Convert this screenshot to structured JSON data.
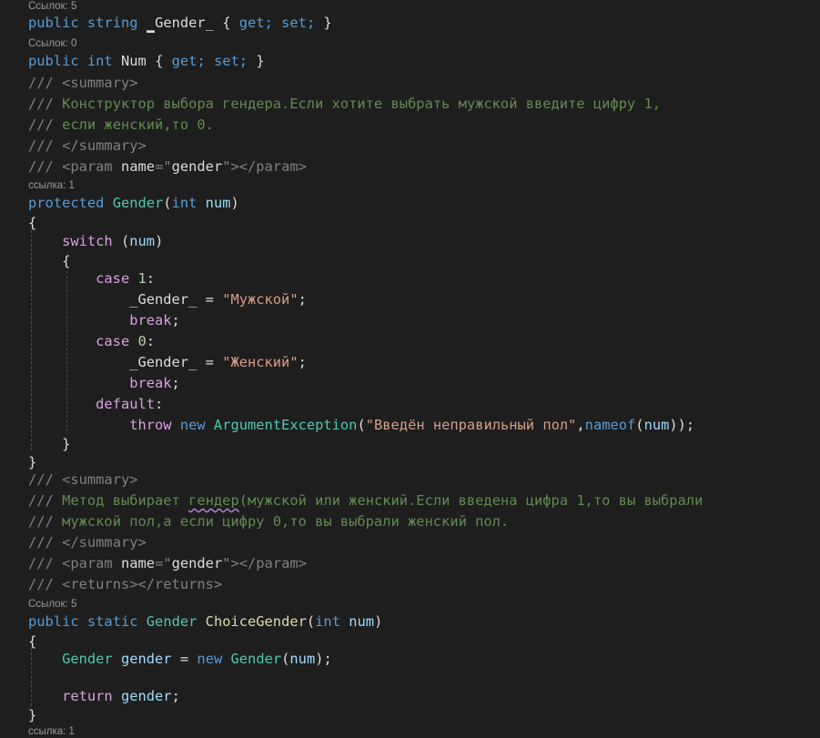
{
  "lenses": {
    "l1": "Ссылок: 5",
    "l2": "Ссылок: 0",
    "l3": "ссылка: 1",
    "l4": "Ссылок: 5",
    "l5": "ссылка: 1"
  },
  "code": {
    "line1": {
      "public": "public",
      "string": "string",
      "cursor_char": "_",
      "name_rest": "Gender_",
      "brace_open": "{",
      "get": "get;",
      "set": "set;",
      "brace_close": "}"
    },
    "line2": {
      "public": "public",
      "int": "int",
      "name": "Num",
      "brace_open": "{",
      "get": "get;",
      "set": "set;",
      "brace_close": "}"
    },
    "line3": {
      "slashes": "///",
      "tag": "<summary>"
    },
    "line4": {
      "slashes": "///",
      "text": "Конструктор выбора гендера.Если хотите выбрать мужской введите цифру 1,"
    },
    "line5": {
      "slashes": "///",
      "text": "если женский,то 0."
    },
    "line6": {
      "slashes": "///",
      "tag": "</summary>"
    },
    "line7": {
      "slashes": "///",
      "tag_open": "<param",
      "attr": "name",
      "eq_quote": "=\"",
      "value": "gender",
      "tag_close": "\"></param>"
    },
    "line8": {
      "protected": "protected",
      "ctor": "Gender",
      "paren_open": "(",
      "int": "int",
      "param": "num",
      "paren_close": ")"
    },
    "line9": {
      "brace": "{"
    },
    "line10": {
      "switch": "switch",
      "paren_open": "(",
      "var": "num",
      "paren_close": ")"
    },
    "line11": {
      "brace": "{"
    },
    "line12": {
      "case": "case",
      "value": "1",
      "colon": ":"
    },
    "line13": {
      "prop": "_Gender_",
      "eq": "=",
      "str": "\"Мужской\"",
      "semi": ";"
    },
    "line14": {
      "break": "break",
      "semi": ";"
    },
    "line15": {
      "case": "case",
      "value": "0",
      "colon": ":"
    },
    "line16": {
      "prop": "_Gender_",
      "eq": "=",
      "str": "\"Женский\"",
      "semi": ";"
    },
    "line17": {
      "break": "break",
      "semi": ";"
    },
    "line18": {
      "default": "default",
      "colon": ":"
    },
    "line19": {
      "throw": "throw",
      "new": "new",
      "type": "ArgumentException",
      "paren_open": "(",
      "str": "\"Введён неправильный пол\"",
      "comma": ",",
      "nameof": "nameof",
      "p2": "(",
      "var": "num",
      "close": "));"
    },
    "line20": {
      "brace": "}"
    },
    "line21": {
      "brace": "}"
    },
    "line22": {
      "slashes": "///",
      "tag": "<summary>"
    },
    "line23": {
      "slashes": "///",
      "text_a": "Метод выбирает",
      "squiggle_word": "гендер",
      "text_b": "(мужской или женский.Если введена цифра 1,то вы выбрали"
    },
    "line24": {
      "slashes": "///",
      "text": "мужской пол,а если цифру 0,то вы выбрали женский пол."
    },
    "line25": {
      "slashes": "///",
      "tag": "</summary>"
    },
    "line26": {
      "slashes": "///",
      "tag_open": "<param",
      "attr": "name",
      "eq_quote": "=\"",
      "value": "gender",
      "tag_close": "\"></param>"
    },
    "line27": {
      "slashes": "///",
      "tag": "<returns></returns>"
    },
    "line28": {
      "public": "public",
      "static": "static",
      "type": "Gender",
      "method": "ChoiceGender",
      "paren_open": "(",
      "int": "int",
      "param": "num",
      "paren_close": ")"
    },
    "line29": {
      "brace": "{"
    },
    "line30": {
      "type": "Gender",
      "var": "gender",
      "eq": "=",
      "new": "new",
      "ctor": "Gender",
      "paren_open": "(",
      "arg": "num",
      "close": ");"
    },
    "line31": {
      "return": "return",
      "var": "gender",
      "semi": ";"
    },
    "line32": {
      "brace": "}"
    }
  },
  "colors": {
    "background": "#1e1e1e",
    "keyword": "#569cd6",
    "control": "#d8a0df",
    "type": "#4ec9b0",
    "parameter": "#9cdcfe",
    "method": "#dcdcaa",
    "string": "#d69d85",
    "number": "#b5cea8",
    "comment": "#57a64a",
    "xml_doc_tag": "#808080",
    "squiggle": "#b180d7"
  }
}
